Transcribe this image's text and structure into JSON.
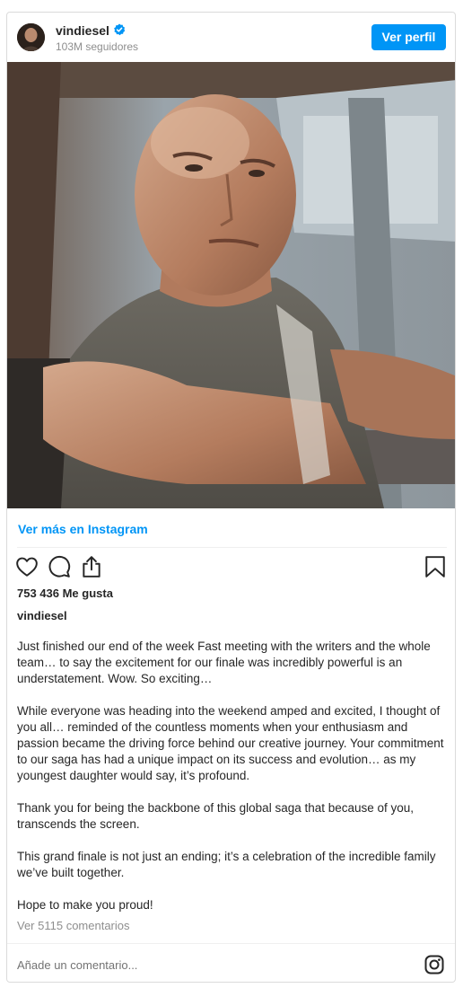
{
  "header": {
    "username": "vindiesel",
    "followers": "103M seguidores",
    "view_profile_label": "Ver perfil",
    "verified_color": "#0095f6"
  },
  "post": {
    "see_more_label": "Ver más en Instagram",
    "likes": "753 436 Me gusta",
    "caption_username": "vindiesel",
    "caption_paragraphs": [
      "Just finished our end of the week Fast meeting with the writers and the whole team… to say the excitement for our finale was incredibly powerful is an understatement. Wow. So exciting…",
      "While everyone was heading into the weekend amped and excited, I thought of you all… reminded of the countless moments when your enthusiasm and passion became the driving force behind our creative journey. Your commitment to our saga has had a unique impact on its success and evolution… as my youngest daughter would say, it’s profound.",
      "Thank you for being the backbone of this global saga that because of you, transcends the screen.",
      "This grand finale is not just an ending; it’s a celebration of the incredible family we’ve built together.",
      "Hope to make you proud!"
    ],
    "comments_link": "Ver 5115 comentarios"
  },
  "comment_box": {
    "placeholder": "Añade un comentario..."
  },
  "icons": {
    "like": "heart-icon",
    "comment": "comment-icon",
    "share": "share-icon",
    "save": "bookmark-icon",
    "instagram": "instagram-icon",
    "verified": "verified-badge-icon"
  },
  "colors": {
    "accent": "#0095f6",
    "text": "#262626",
    "muted": "#8e8e8e",
    "border": "#dbdbdb"
  }
}
